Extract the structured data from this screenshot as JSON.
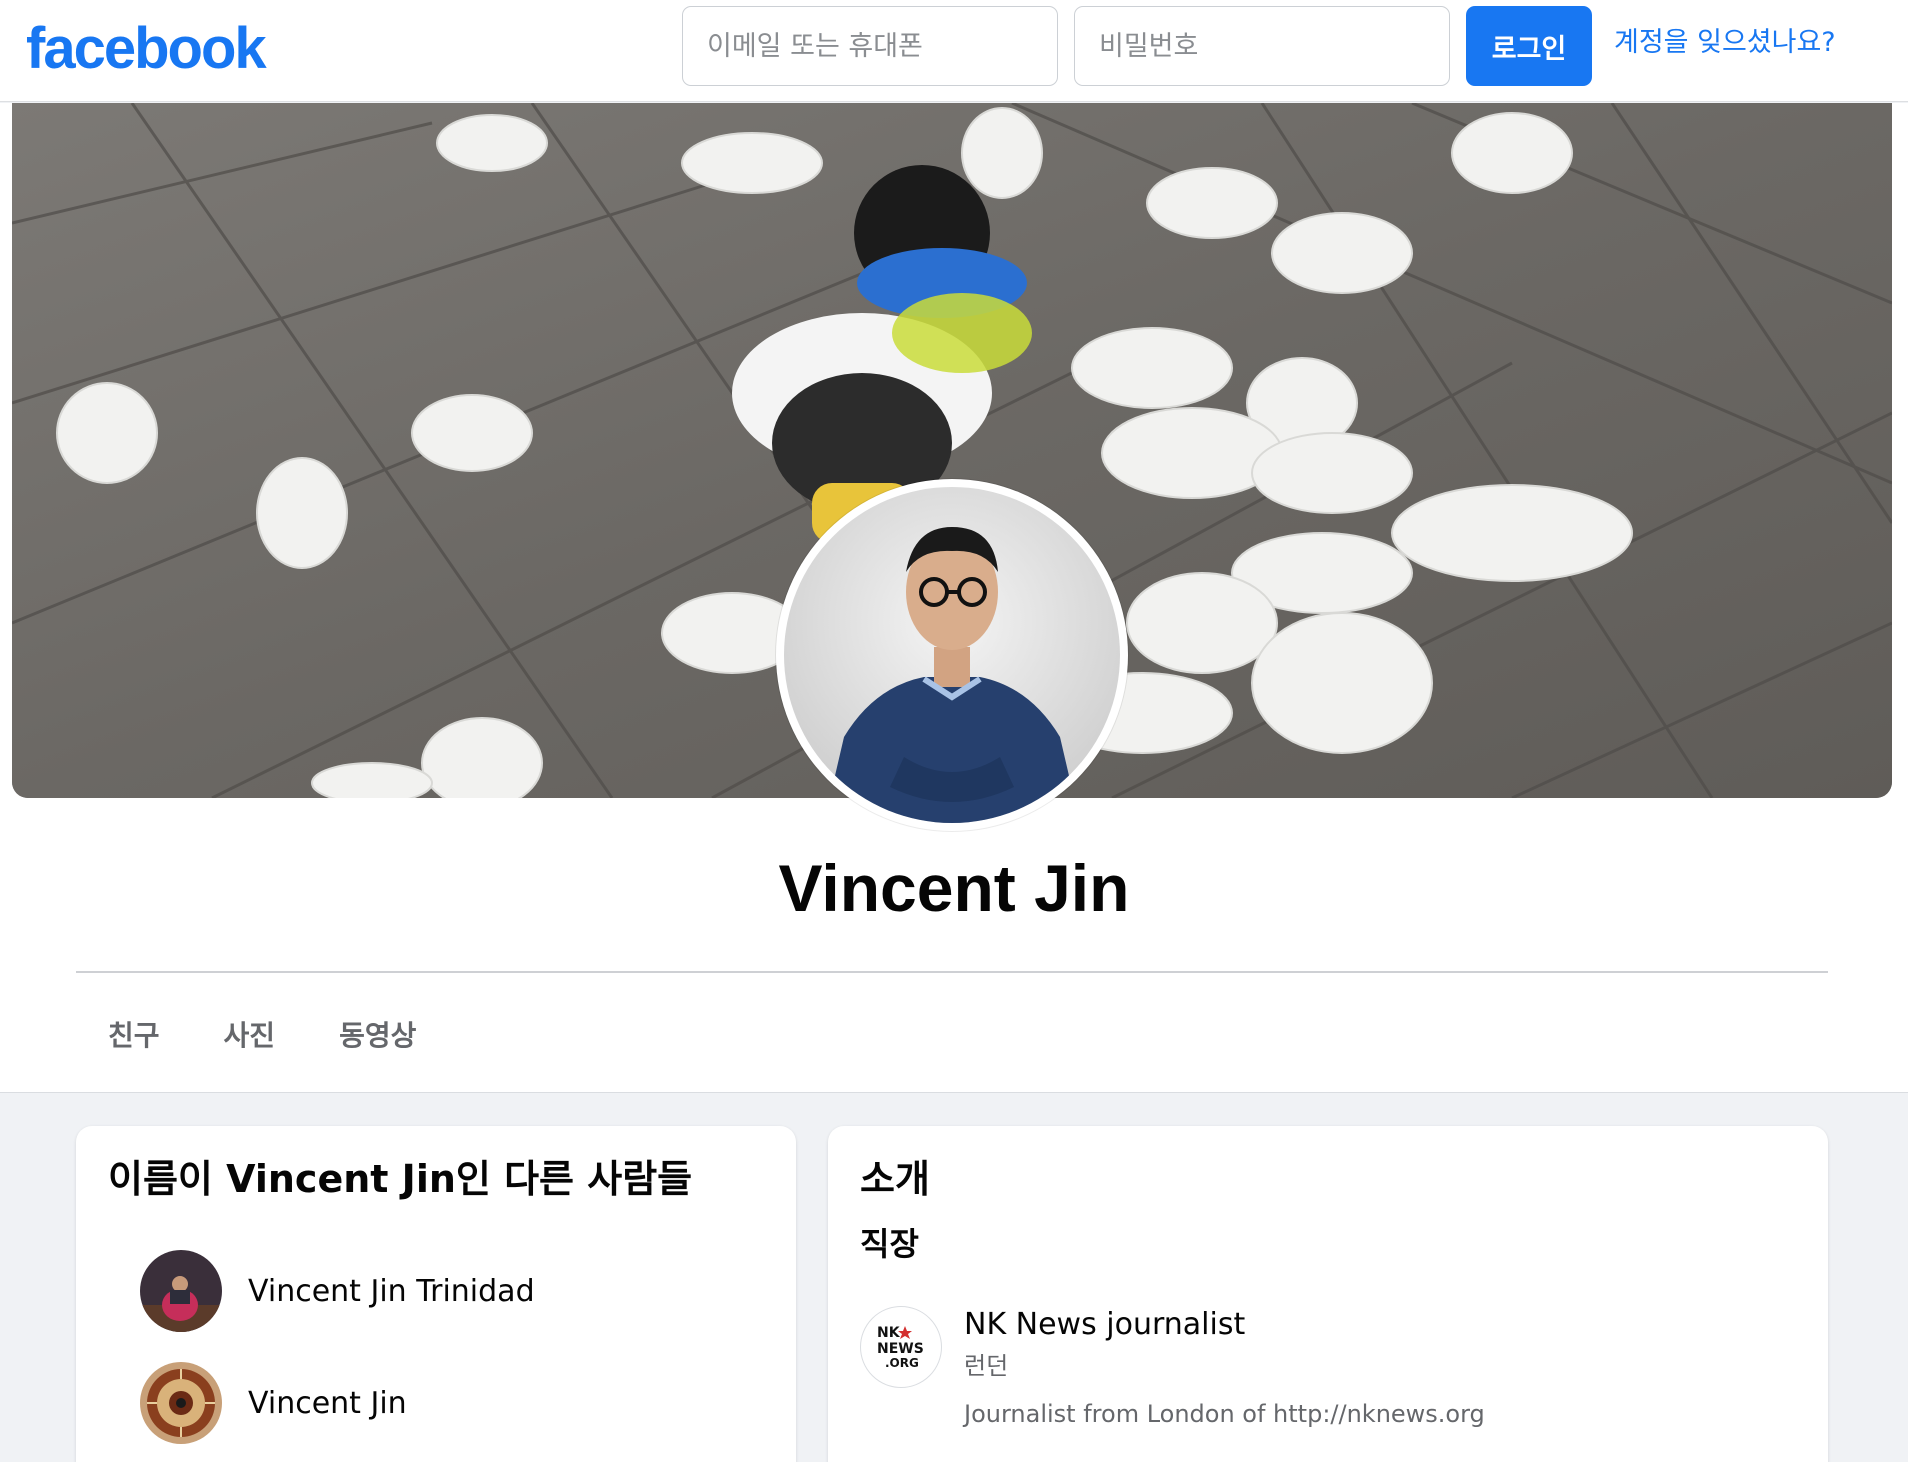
{
  "app": {
    "brand": "facebook",
    "accent_color": "#1877f2"
  },
  "login": {
    "email_placeholder": "이메일 또는 휴대폰",
    "password_placeholder": "비밀번호",
    "login_label": "로그인",
    "forgot_label": "계정을 잊으셨나요?"
  },
  "profile": {
    "name": "Vincent Jin",
    "cover_description_icon": "pigeons-photo",
    "tabs": [
      {
        "label": "친구"
      },
      {
        "label": "사진"
      },
      {
        "label": "동영상"
      }
    ]
  },
  "others": {
    "title": "이름이 Vincent Jin인 다른 사람들",
    "people": [
      {
        "name": "Vincent Jin Trinidad"
      },
      {
        "name": "Vincent Jin"
      }
    ]
  },
  "intro": {
    "title": "소개",
    "work_heading": "직장",
    "work": {
      "title": "NK News journalist",
      "location": "런던",
      "description": "Journalist from London of http://nknews.org",
      "logo_text": [
        "NK",
        "NEWS",
        ".ORG"
      ]
    }
  }
}
